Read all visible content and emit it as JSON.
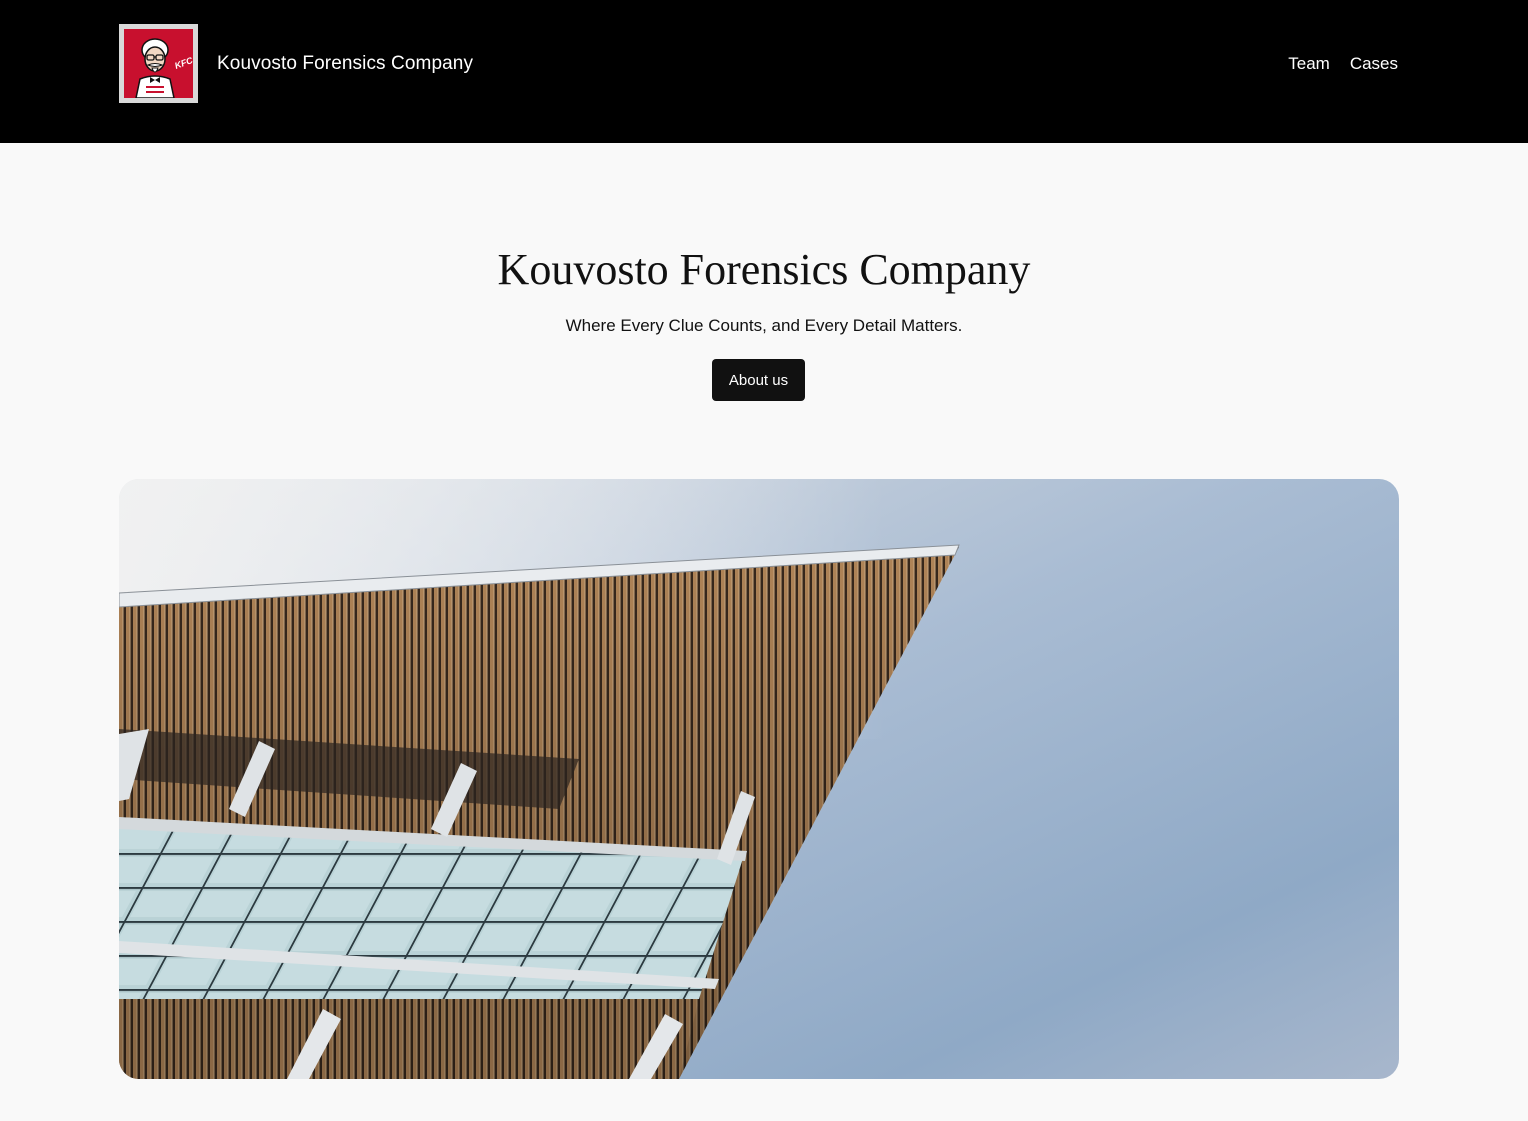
{
  "header": {
    "logo_icon": "colonel-portrait-logo-icon",
    "logo_text": "KFC",
    "site_title": "Kouvosto Forensics Company",
    "nav": [
      {
        "label": "Team"
      },
      {
        "label": "Cases"
      }
    ]
  },
  "hero": {
    "title": "Kouvosto Forensics Company",
    "subtitle": "Where Every Clue Counts, and Every Detail Matters.",
    "button_label": "About us",
    "image_subject": "modern-building-facade-photo"
  },
  "colors": {
    "header_bg": "#000000",
    "page_bg": "#f9f9f9",
    "text": "#111111",
    "button_bg": "#111111",
    "button_text": "#ffffff",
    "logo_red": "#c8102e"
  }
}
